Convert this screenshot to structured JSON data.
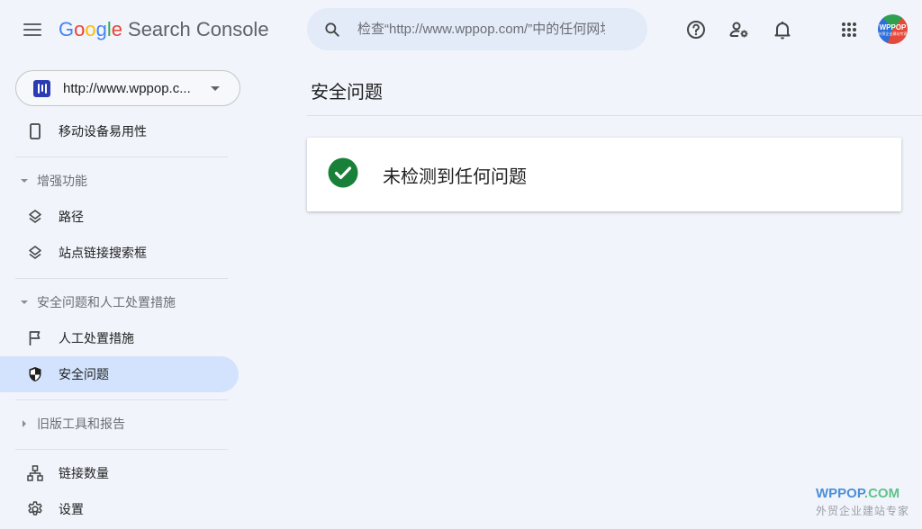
{
  "header": {
    "logo": {
      "google": [
        "G",
        "o",
        "o",
        "g",
        "l",
        "e"
      ],
      "product": "Search Console"
    },
    "search": {
      "placeholder": "检查“http://www.wppop.com/”中的任何网址"
    },
    "icons": [
      "help-icon",
      "manage-users-icon",
      "notifications-icon",
      "apps-grid-icon"
    ],
    "avatar": {
      "line1": "WPPOP",
      "line2": "外贸企业建站专家"
    }
  },
  "sidebar": {
    "property": {
      "label": "http://www.wppop.c..."
    },
    "items": {
      "mobile": {
        "label": "移动设备易用性",
        "icon": "phone-icon"
      },
      "enhancements_section": {
        "label": "增强功能",
        "expanded": true
      },
      "breadcrumbs": {
        "label": "路径",
        "icon": "layers-icon"
      },
      "sitelinks": {
        "label": "站点链接搜索框",
        "icon": "layers-icon"
      },
      "security_section": {
        "label": "安全问题和人工处置措施",
        "expanded": true
      },
      "manual_actions": {
        "label": "人工处置措施",
        "icon": "flag-icon"
      },
      "security_issues": {
        "label": "安全问题",
        "icon": "shield-icon",
        "active": true
      },
      "legacy_section": {
        "label": "旧版工具和报告",
        "expanded": false
      },
      "links": {
        "label": "链接数量",
        "icon": "sitemap-icon"
      },
      "settings": {
        "label": "设置",
        "icon": "gear-icon"
      }
    }
  },
  "main": {
    "title": "安全问题",
    "status_card": {
      "text": "未检测到任何问题",
      "status": "ok",
      "color": "#188038"
    }
  },
  "watermark": {
    "brand_a": "WPPOP",
    "brand_b": ".COM",
    "tagline": "外贸企业建站专家"
  }
}
